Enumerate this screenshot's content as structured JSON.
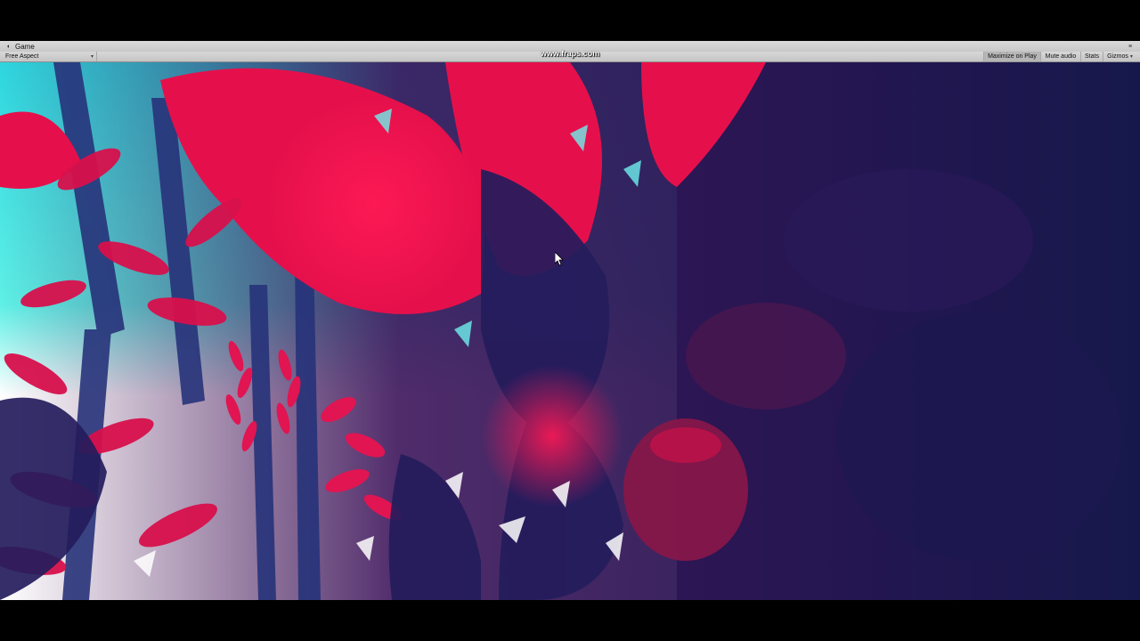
{
  "window": {
    "tab_label": "Game",
    "tab_icon": "game-controller-icon"
  },
  "toolbar": {
    "aspect_label": "Free Aspect",
    "maximize_label": "Maximize on Play",
    "mute_label": "Mute audio",
    "stats_label": "Stats",
    "gizmos_label": "Gizmos"
  },
  "overlay": {
    "watermark": "www.fraps.com"
  },
  "scene": {
    "description_colors": {
      "sky": "#3ee6e0",
      "foliage_red": "#e0104a",
      "foliage_dark": "#221a5a",
      "light": "#ffffff"
    }
  }
}
